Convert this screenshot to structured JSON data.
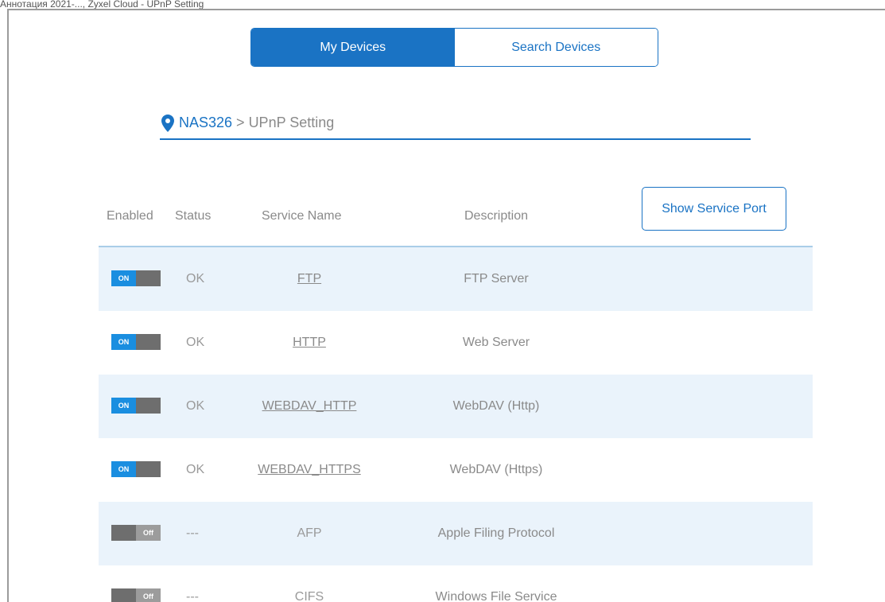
{
  "window": {
    "caption": "Аннотация 2021-..., Zyxel Cloud - UPnP Setting"
  },
  "tabs": {
    "my_devices": "My Devices",
    "search_devices": "Search Devices"
  },
  "breadcrumb": {
    "device": "NAS326",
    "separator": ">",
    "current": "UPnP Setting"
  },
  "table": {
    "headers": {
      "enabled": "Enabled",
      "status": "Status",
      "service_name": "Service Name",
      "description": "Description"
    },
    "show_port_button": "Show Service Port",
    "rows": [
      {
        "enabled": true,
        "toggle_label": "ON",
        "status": "OK",
        "name": "FTP",
        "description": "FTP Server"
      },
      {
        "enabled": true,
        "toggle_label": "ON",
        "status": "OK",
        "name": "HTTP",
        "description": "Web Server"
      },
      {
        "enabled": true,
        "toggle_label": "ON",
        "status": "OK",
        "name": "WEBDAV_HTTP",
        "description": "WebDAV (Http)"
      },
      {
        "enabled": true,
        "toggle_label": "ON",
        "status": "OK",
        "name": "WEBDAV_HTTPS",
        "description": "WebDAV (Https)"
      },
      {
        "enabled": false,
        "toggle_label": "Off",
        "status": "---",
        "name": "AFP",
        "description": "Apple Filing Protocol"
      },
      {
        "enabled": false,
        "toggle_label": "Off",
        "status": "---",
        "name": "CIFS",
        "description": "Windows File Service"
      }
    ]
  },
  "colors": {
    "accent": "#1a73c4",
    "row_shade": "#eaf3fb",
    "toggle_on": "#1a8ee0",
    "toggle_off": "#6e6e6e"
  }
}
